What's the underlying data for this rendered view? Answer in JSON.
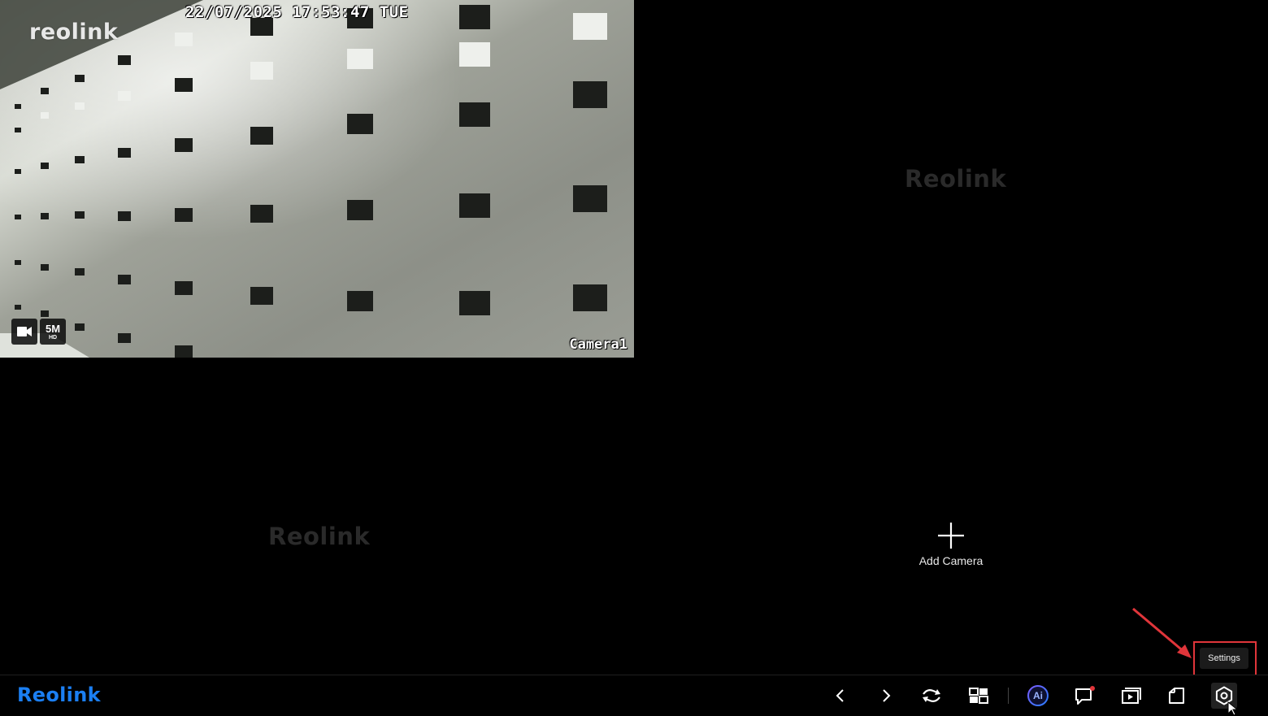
{
  "camera_tile": {
    "timestamp": "22/07/2025 17:53:47 TUE",
    "logo": "reolink",
    "camera_name": "Camera1",
    "resolution_main": "5M",
    "resolution_sub": "HD",
    "record_icon": "video-camera-icon"
  },
  "empty_tiles": {
    "watermark_top_right": "Reolink",
    "watermark_bottom_left": "Reolink",
    "add_camera_label": "Add Camera"
  },
  "tooltip": {
    "text": "Settings"
  },
  "toolbar": {
    "brand": "Reolink",
    "brand_color": "#1b7ff3",
    "buttons": [
      {
        "name": "previous-page",
        "icon": "chevron-left-icon"
      },
      {
        "name": "next-page",
        "icon": "chevron-right-icon"
      },
      {
        "name": "switch-stream",
        "icon": "swap-arrows-icon"
      },
      {
        "name": "layout",
        "icon": "grid-layout-icon"
      },
      {
        "name": "ai",
        "icon": "ai-icon",
        "label": "Ai"
      },
      {
        "name": "messages",
        "icon": "message-icon",
        "notification": true
      },
      {
        "name": "playback",
        "icon": "playback-icon"
      },
      {
        "name": "files",
        "icon": "folder-icon"
      },
      {
        "name": "settings",
        "icon": "gear-icon"
      }
    ]
  },
  "annotation": {
    "color": "#e0353a"
  }
}
